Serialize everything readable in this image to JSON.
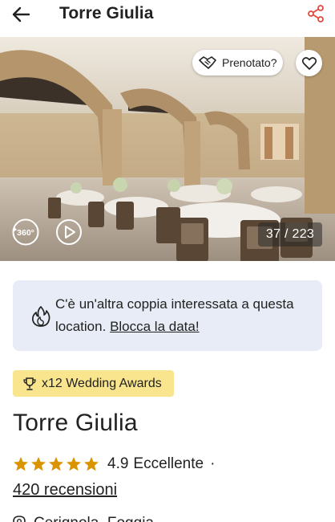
{
  "header": {
    "title": "Torre Giulia",
    "back_icon": "arrow-left-icon",
    "share_icon": "share-icon",
    "share_color": "#e04a3f"
  },
  "gallery": {
    "booked_label": "Prenotato?",
    "booked_icon": "handshake-icon",
    "favorite_icon": "heart-outline-icon",
    "view360_label": "360°",
    "play_icon": "play-circle-icon",
    "photo_counter": "37 / 223"
  },
  "notice": {
    "icon": "flame-icon",
    "text": "C'è un'altra coppia interessata a questa location.",
    "link_label": "Blocca la data!",
    "background": "#e8ecf6"
  },
  "awards": {
    "label": "x12 Wedding Awards",
    "icon": "trophy-icon",
    "background": "#f8e58d"
  },
  "venue": {
    "name": "Torre Giulia",
    "rating": "4.9",
    "stars": 5,
    "rating_word": "Eccellente",
    "separator": "·",
    "reviews_label": "420 recensioni",
    "star_color": "#d99400",
    "location_icon": "map-pin-icon",
    "location_text": "Cerignola, Foggia"
  }
}
